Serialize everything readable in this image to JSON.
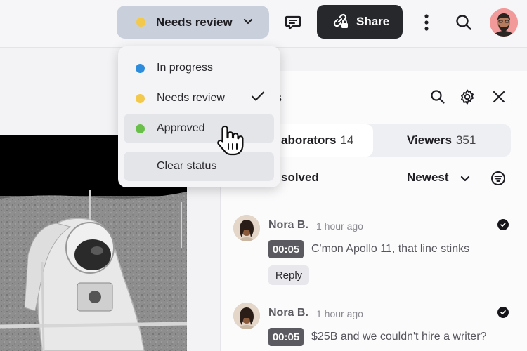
{
  "topbar": {
    "status_label": "Needs review",
    "status_color": "#f2c94c",
    "share_label": "Share"
  },
  "status_menu": {
    "items": [
      {
        "label": "In progress",
        "color": "#2d8cdc"
      },
      {
        "label": "Needs review",
        "color": "#f2c94c",
        "selected": true
      },
      {
        "label": "Approved",
        "color": "#6abf4b",
        "hovered": true
      }
    ],
    "clear_label": "Clear status"
  },
  "panel": {
    "title_partial": "ents",
    "tabs": [
      {
        "label": "aborators",
        "count": "14"
      },
      {
        "label": "Viewers",
        "count": "351"
      }
    ],
    "filter_label": "solved",
    "sort_label": "Newest"
  },
  "comments": [
    {
      "author": "Nora B.",
      "time": "1 hour ago",
      "timestamp": "00:05",
      "text": "C'mon Apollo 11, that line stinks",
      "reply_label": "Reply"
    },
    {
      "author": "Nora B.",
      "time": "1 hour ago",
      "timestamp": "00:05",
      "text": "$25B and we couldn't hire a writer?"
    }
  ]
}
